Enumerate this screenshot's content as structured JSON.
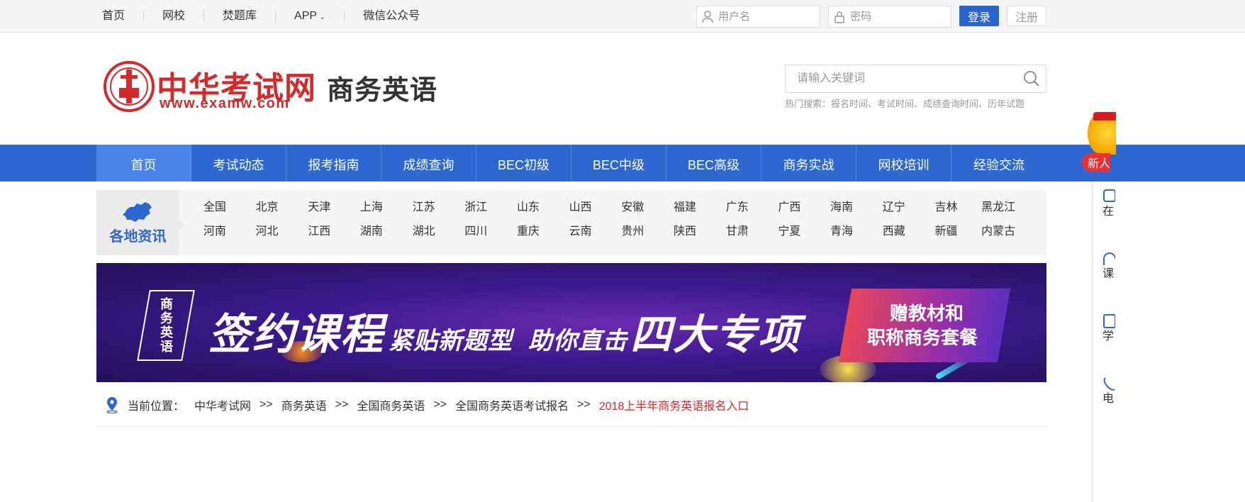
{
  "topbar": {
    "links": [
      {
        "label": "首页"
      },
      {
        "label": "网校"
      },
      {
        "label": "焚题库"
      },
      {
        "label": "APP"
      },
      {
        "label": "微信公众号"
      }
    ],
    "username_placeholder": "用户名",
    "password_placeholder": "密码",
    "login_label": "登录",
    "register_label": "注册"
  },
  "header": {
    "logo_text": "中华考试网",
    "logo_url": "www.examw.com",
    "site_title": "商务英语",
    "search_placeholder": "请输入关键词",
    "hot_search": "热门搜索：报名时间、考试时间、成绩查询时间、历年试题"
  },
  "nav": {
    "items": [
      {
        "label": "首页"
      },
      {
        "label": "考试动态"
      },
      {
        "label": "报考指南"
      },
      {
        "label": "成绩查询"
      },
      {
        "label": "BEC初级"
      },
      {
        "label": "BEC中级"
      },
      {
        "label": "BEC高级"
      },
      {
        "label": "商务实战"
      },
      {
        "label": "网校培训"
      },
      {
        "label": "经验交流"
      }
    ]
  },
  "region": {
    "label": "各地资讯",
    "places": [
      "全国",
      "北京",
      "天津",
      "上海",
      "江苏",
      "浙江",
      "山东",
      "山西",
      "安徽",
      "福建",
      "广东",
      "广西",
      "海南",
      "辽宁",
      "吉林",
      "黑龙江",
      "河南",
      "河北",
      "江西",
      "湖南",
      "湖北",
      "四川",
      "重庆",
      "云南",
      "贵州",
      "陕西",
      "甘肃",
      "宁夏",
      "青海",
      "西藏",
      "新疆",
      "内蒙古"
    ]
  },
  "banner": {
    "tag": "商务英语",
    "headline1": "签约课程",
    "headline2": "紧贴新题型",
    "headline3": "助你直击",
    "headline4": "四大专项",
    "box_line1": "赠教材和",
    "box_line2": "职称商务套餐"
  },
  "breadcrumb": {
    "label": "当前位置：",
    "items": [
      "中华考试网",
      "商务英语",
      "全国商务英语",
      "全国商务英语考试报名"
    ],
    "separator": ">>",
    "current": "2018上半年商务英语报名入口"
  },
  "sidebar": {
    "newbie_label": "新人",
    "items": [
      {
        "label": "在线咨询",
        "icon": "chat-icon"
      },
      {
        "label": "课程试听",
        "icon": "headphone-icon"
      },
      {
        "label": "学员服务",
        "icon": "user-service-icon"
      },
      {
        "label": "电话咨询",
        "icon": "phone-icon"
      }
    ]
  },
  "colors": {
    "brand_blue": "#2e67cf",
    "brand_red": "#d32b2b",
    "current_crumb": "#e62222"
  }
}
